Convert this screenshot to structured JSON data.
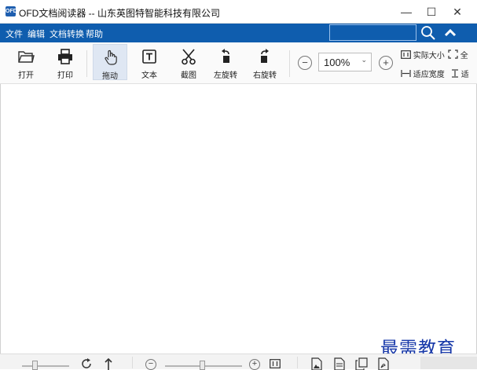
{
  "window": {
    "app_icon_text": "OFD",
    "title": "OFD文档阅读器 -- 山东英图特智能科技有限公司",
    "minimize_glyph": "—",
    "maximize_glyph": "☐",
    "close_glyph": "✕"
  },
  "menu": {
    "items": [
      {
        "label": "文件"
      },
      {
        "label": "编辑"
      },
      {
        "label": "文档转换"
      },
      {
        "label": "帮助"
      }
    ],
    "search_value": ""
  },
  "toolbar": {
    "tools": [
      {
        "label": "打开",
        "icon": "folder-icon"
      },
      {
        "label": "打印",
        "icon": "printer-icon"
      },
      {
        "label": "拖动",
        "icon": "hand-icon",
        "active": true
      },
      {
        "label": "文本",
        "icon": "text-icon"
      },
      {
        "label": "截图",
        "icon": "scissors-icon"
      },
      {
        "label": "左旋转",
        "icon": "rotate-left-icon"
      },
      {
        "label": "右旋转",
        "icon": "rotate-right-icon"
      }
    ],
    "zoom_out_glyph": "−",
    "zoom_in_glyph": "+",
    "zoom_value": "100%",
    "actual_size_label": "实际大小",
    "fit_width_label": "适应宽度",
    "full_label": "全",
    "fit_label": "适"
  },
  "status": {
    "zoom_out_glyph": "−",
    "zoom_in_glyph": "+"
  },
  "watermark": "最需教育",
  "colors": {
    "menubar": "#0f5dae",
    "active_tool": "#dfe7f3",
    "watermark": "#1637a8"
  }
}
